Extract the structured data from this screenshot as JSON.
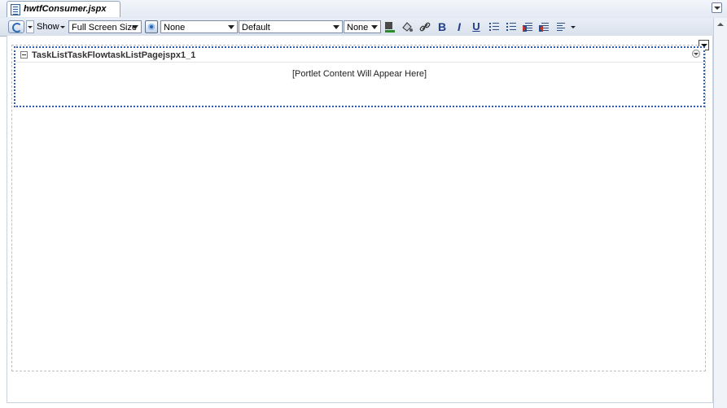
{
  "tab": {
    "title": "hwtfConsumer.jspx"
  },
  "toolbar": {
    "show_label": "Show",
    "screen_size": "Full Screen Size",
    "style_class": "None",
    "font_family": "Default",
    "font_size": "None",
    "bold": "B",
    "italic": "I",
    "underline": "U"
  },
  "portlet": {
    "title": "TaskListTaskFlowtaskListPagejspx1_1",
    "content": "[Portlet Content Will Appear Here]"
  }
}
